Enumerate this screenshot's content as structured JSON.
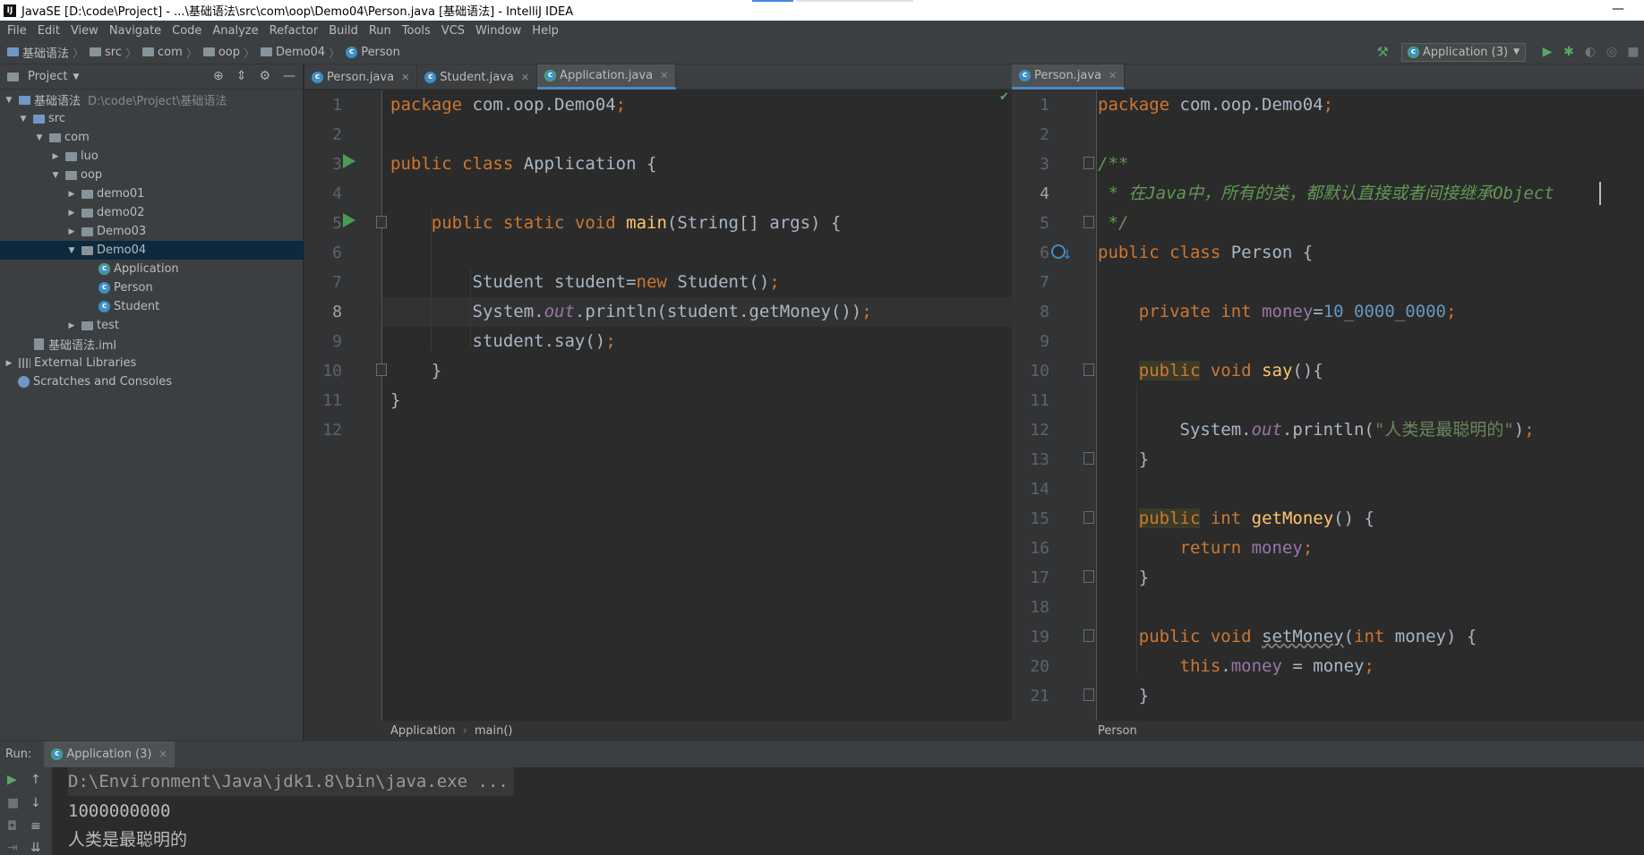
{
  "window": {
    "title": "JavaSE [D:\\code\\Project] - ...\\基础语法\\src\\com\\oop\\Demo04\\Person.java [基础语法] - IntelliJ IDEA",
    "app_icon": "IJ"
  },
  "menu": [
    "File",
    "Edit",
    "View",
    "Navigate",
    "Code",
    "Analyze",
    "Refactor",
    "Build",
    "Run",
    "Tools",
    "VCS",
    "Window",
    "Help"
  ],
  "navbar": {
    "crumbs": [
      "基础语法",
      "src",
      "com",
      "oop",
      "Demo04",
      "Person"
    ],
    "run_config": "Application (3)"
  },
  "project": {
    "title": "Project",
    "tree": [
      {
        "label": "基础语法",
        "path": "D:\\code\\Project\\基础语法",
        "icon": "project-folder-icon"
      },
      {
        "label": "src",
        "icon": "folder-icon"
      },
      {
        "label": "com",
        "icon": "folder-icon"
      },
      {
        "label": "luo",
        "icon": "folder-icon"
      },
      {
        "label": "oop",
        "icon": "folder-icon"
      },
      {
        "label": "demo01",
        "icon": "folder-icon"
      },
      {
        "label": "demo02",
        "icon": "folder-icon"
      },
      {
        "label": "Demo03",
        "icon": "folder-icon"
      },
      {
        "label": "Demo04",
        "icon": "folder-icon",
        "selected": true
      },
      {
        "label": "Application",
        "icon": "class-icon"
      },
      {
        "label": "Person",
        "icon": "class-icon"
      },
      {
        "label": "Student",
        "icon": "class-icon"
      },
      {
        "label": "test",
        "icon": "folder-icon"
      },
      {
        "label": "基础语法.iml",
        "icon": "module-file-icon"
      },
      {
        "label": "External Libraries",
        "icon": "libraries-icon"
      },
      {
        "label": "Scratches and Consoles",
        "icon": "scratches-icon"
      }
    ]
  },
  "left_editor": {
    "tabs": [
      "Person.java",
      "Student.java",
      "Application.java"
    ],
    "active_tab": "Application.java",
    "line_numbers": [
      "1",
      "2",
      "3",
      "4",
      "5",
      "6",
      "7",
      "8",
      "9",
      "10",
      "11",
      "12"
    ],
    "breadcrumb": [
      "Application",
      "main()"
    ]
  },
  "right_editor": {
    "tabs": [
      "Person.java"
    ],
    "active_tab": "Person.java",
    "line_numbers": [
      "1",
      "2",
      "3",
      "4",
      "5",
      "6",
      "7",
      "8",
      "9",
      "10",
      "11",
      "12",
      "13",
      "14",
      "15",
      "16",
      "17",
      "18",
      "19",
      "20",
      "21"
    ],
    "breadcrumb": [
      "Person"
    ]
  },
  "run": {
    "label": "Run:",
    "tab": "Application (3)",
    "output": [
      "D:\\Environment\\Java\\jdk1.8\\bin\\java.exe ...",
      "1000000000",
      "人类是最聪明的"
    ]
  },
  "colors": {
    "accent": "#4a88c7",
    "run_green": "#499c54",
    "keyword": "#cc7832",
    "string": "#6a8759"
  }
}
